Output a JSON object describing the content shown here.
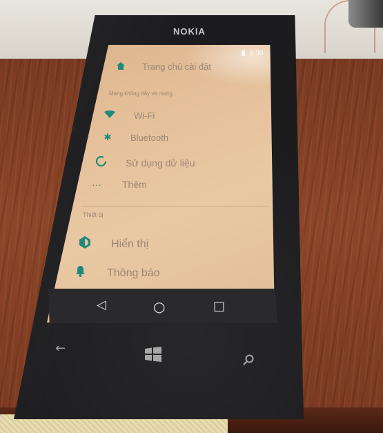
{
  "device": {
    "brand": "NOKIA"
  },
  "status_bar": {
    "time": "6:30"
  },
  "settings": {
    "header": {
      "title": "Trang chủ cài đặt",
      "icon": "home-icon"
    },
    "sections": [
      {
        "title": "Mạng không dây và mạng",
        "items": [
          {
            "label": "Wi-Fi",
            "icon": "wifi-icon"
          },
          {
            "label": "Bluetooth",
            "icon": "bluetooth-icon"
          },
          {
            "label": "Sử dụng dữ liệu",
            "icon": "data-usage-icon"
          },
          {
            "label": "Thêm",
            "icon": "more-icon"
          }
        ]
      },
      {
        "title": "Thiết bị",
        "items": [
          {
            "label": "Hiển thị",
            "icon": "display-icon"
          },
          {
            "label": "Thông báo",
            "icon": "notification-bell-icon"
          }
        ]
      }
    ]
  },
  "nav_bar": {
    "buttons": [
      {
        "name": "back",
        "glyph": "◁"
      },
      {
        "name": "home",
        "glyph": "○"
      },
      {
        "name": "recents",
        "glyph": "□"
      }
    ]
  },
  "hardware_buttons": [
    {
      "name": "back",
      "glyph": "←"
    },
    {
      "name": "windows-start",
      "glyph": "⊞"
    },
    {
      "name": "search",
      "glyph": "⚲"
    }
  ],
  "colors": {
    "accent": "#1f8a7a",
    "screen_bg": "#e6c29c",
    "text": "#9c8574",
    "nav_bar": "#2a2a2c"
  }
}
